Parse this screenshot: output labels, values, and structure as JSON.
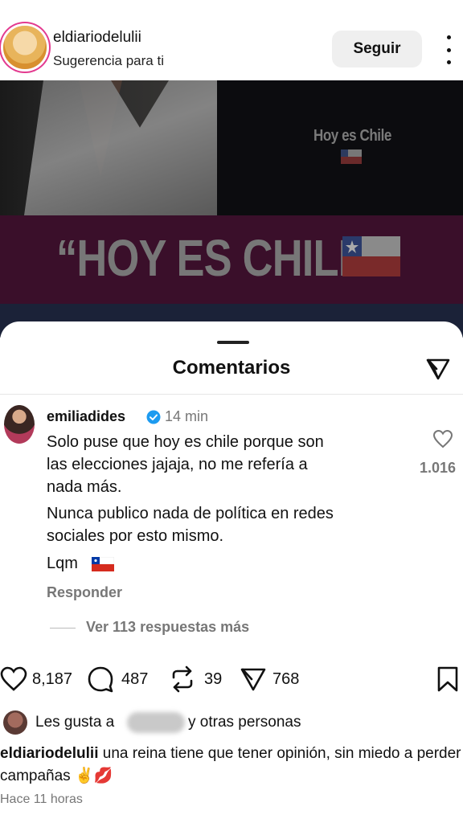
{
  "header": {
    "username": "eldiariodelulii",
    "subtitle": "Sugerencia para ti",
    "follow_label": "Seguir"
  },
  "post": {
    "small_title": "Hoy es Chile",
    "big_title": "“HOY ES CHILE”"
  },
  "comments_sheet": {
    "title": "Comentarios",
    "comment": {
      "username": "emiliadides",
      "time": "14 min",
      "text_lines": [
        "Solo puse que hoy es chile porque son",
        "las elecciones jajaja, no me refería a",
        "nada más.",
        "Nunca publico nada de política en redes",
        "sociales por esto mismo.",
        "Lqm"
      ],
      "likes": "1.016",
      "reply_label": "Responder",
      "more_replies_label": "Ver 113 respuestas más"
    }
  },
  "actions": {
    "likes": "8,187",
    "comments": "487",
    "reposts": "39",
    "shares": "768"
  },
  "liked_by": {
    "prefix": "Les gusta a",
    "suffix": "y otras personas"
  },
  "caption": {
    "username": "eldiariodelulii",
    "text": "una reina tiene que tener opinión, sin miedo a perder campañas ✌️💋"
  },
  "timestamp": "Hace 11 horas",
  "colors": {
    "accent_ring": "#e33a8f",
    "verified_blue": "#1d9bf0",
    "muted_text": "#777777",
    "band": "#3a0f2a"
  },
  "icons": [
    "more-vertical-icon",
    "send-icon",
    "verified-icon",
    "heart-icon",
    "comment-icon",
    "repost-icon",
    "bookmark-icon",
    "chile-flag-icon"
  ]
}
